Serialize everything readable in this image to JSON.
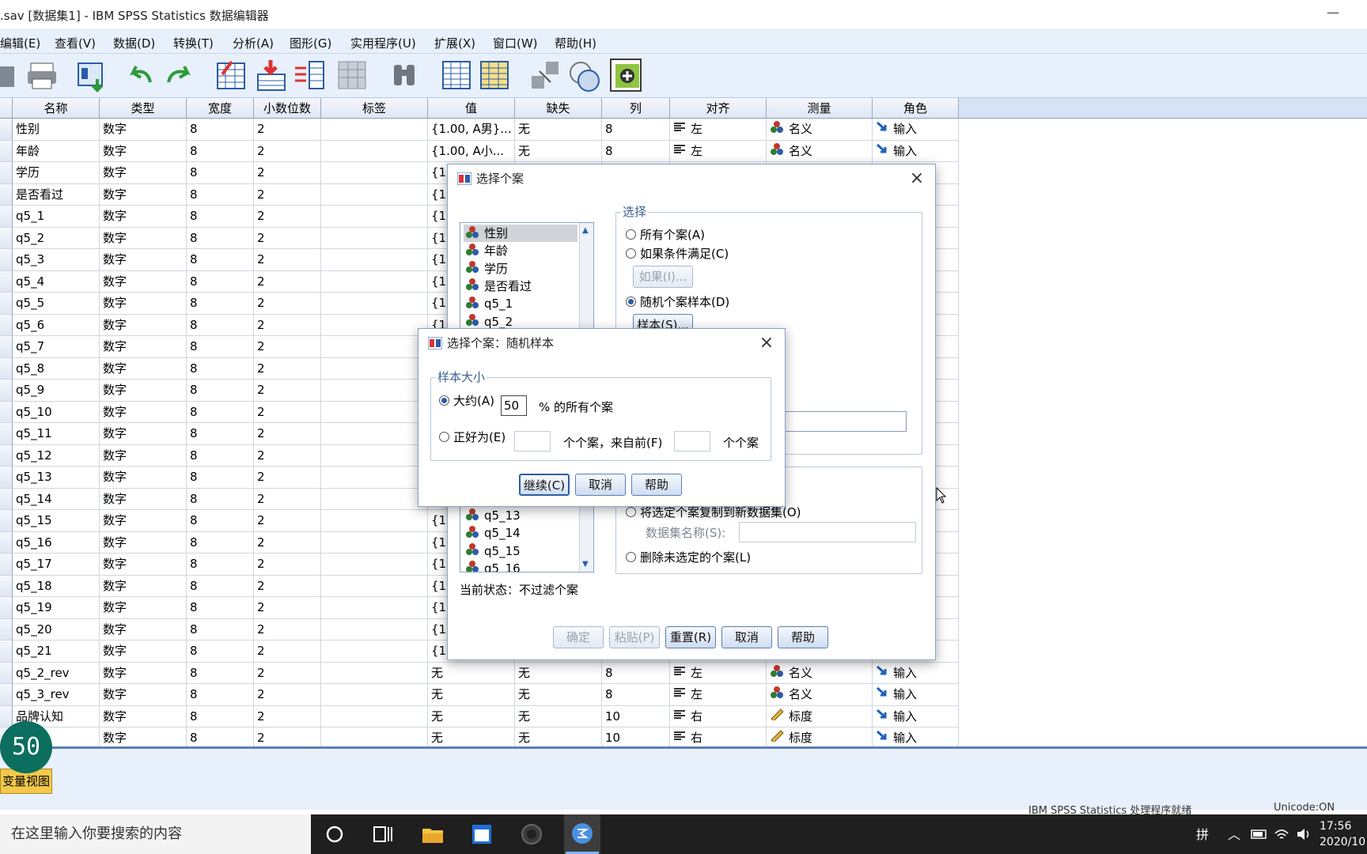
{
  "window": {
    "title": ".sav [数据集1] - IBM SPSS Statistics 数据编辑器",
    "minimize": "—"
  },
  "menu": [
    "编辑(E)",
    "查看(V)",
    "数据(D)",
    "转换(T)",
    "分析(A)",
    "图形(G)",
    "实用程序(U)",
    "扩展(X)",
    "窗口(W)",
    "帮助(H)"
  ],
  "columns": [
    "名称",
    "类型",
    "宽度",
    "小数位数",
    "标签",
    "值",
    "缺失",
    "列",
    "对齐",
    "测量",
    "角色"
  ],
  "rows": [
    [
      "性别",
      "数字",
      "8",
      "2",
      "",
      "{1.00, A男}...",
      "无",
      "8",
      "左",
      "名义",
      "输入"
    ],
    [
      "年龄",
      "数字",
      "8",
      "2",
      "",
      "{1.00, A小...",
      "无",
      "8",
      "左",
      "名义",
      "输入"
    ],
    [
      "学历",
      "数字",
      "8",
      "2",
      "",
      "{1.0",
      "",
      "",
      "",
      "",
      ""
    ],
    [
      "是否看过",
      "数字",
      "8",
      "2",
      "",
      "{1.0",
      "",
      "",
      "",
      "",
      ""
    ],
    [
      "q5_1",
      "数字",
      "8",
      "2",
      "",
      "{1.0",
      "",
      "",
      "",
      "",
      ""
    ],
    [
      "q5_2",
      "数字",
      "8",
      "2",
      "",
      "{1.0",
      "",
      "",
      "",
      "",
      ""
    ],
    [
      "q5_3",
      "数字",
      "8",
      "2",
      "",
      "{1.0",
      "",
      "",
      "",
      "",
      ""
    ],
    [
      "q5_4",
      "数字",
      "8",
      "2",
      "",
      "{1.0",
      "",
      "",
      "",
      "",
      ""
    ],
    [
      "q5_5",
      "数字",
      "8",
      "2",
      "",
      "{1.0",
      "",
      "",
      "",
      "",
      ""
    ],
    [
      "q5_6",
      "数字",
      "8",
      "2",
      "",
      "{1.0",
      "",
      "",
      "",
      "",
      ""
    ],
    [
      "q5_7",
      "数字",
      "8",
      "2",
      "",
      "",
      "",
      "",
      "",
      "",
      ""
    ],
    [
      "q5_8",
      "数字",
      "8",
      "2",
      "",
      "",
      "",
      "",
      "",
      "",
      ""
    ],
    [
      "q5_9",
      "数字",
      "8",
      "2",
      "",
      "",
      "",
      "",
      "",
      "",
      ""
    ],
    [
      "q5_10",
      "数字",
      "8",
      "2",
      "",
      "",
      "",
      "",
      "",
      "",
      ""
    ],
    [
      "q5_11",
      "数字",
      "8",
      "2",
      "",
      "",
      "",
      "",
      "",
      "",
      ""
    ],
    [
      "q5_12",
      "数字",
      "8",
      "2",
      "",
      "",
      "",
      "",
      "",
      "",
      ""
    ],
    [
      "q5_13",
      "数字",
      "8",
      "2",
      "",
      "",
      "",
      "",
      "",
      "",
      ""
    ],
    [
      "q5_14",
      "数字",
      "8",
      "2",
      "",
      "",
      "",
      "",
      "",
      "",
      ""
    ],
    [
      "q5_15",
      "数字",
      "8",
      "2",
      "",
      "{1.0",
      "",
      "",
      "",
      "",
      ""
    ],
    [
      "q5_16",
      "数字",
      "8",
      "2",
      "",
      "{1.0",
      "",
      "",
      "",
      "",
      ""
    ],
    [
      "q5_17",
      "数字",
      "8",
      "2",
      "",
      "{1.0",
      "",
      "",
      "",
      "",
      ""
    ],
    [
      "q5_18",
      "数字",
      "8",
      "2",
      "",
      "{1.0",
      "",
      "",
      "",
      "",
      ""
    ],
    [
      "q5_19",
      "数字",
      "8",
      "2",
      "",
      "{1.0",
      "",
      "",
      "",
      "",
      ""
    ],
    [
      "q5_20",
      "数字",
      "8",
      "2",
      "",
      "{1.0",
      "",
      "",
      "",
      "",
      ""
    ],
    [
      "q5_21",
      "数字",
      "8",
      "2",
      "",
      "{1.0",
      "",
      "",
      "",
      "",
      ""
    ],
    [
      "q5_2_rev",
      "数字",
      "8",
      "2",
      "",
      "无",
      "无",
      "8",
      "左",
      "名义",
      "输入"
    ],
    [
      "q5_3_rev",
      "数字",
      "8",
      "2",
      "",
      "无",
      "无",
      "8",
      "左",
      "名义",
      "输入"
    ],
    [
      "品牌认知",
      "数字",
      "8",
      "2",
      "",
      "无",
      "无",
      "10",
      "右",
      "标度",
      "输入"
    ],
    [
      "感",
      "数字",
      "8",
      "2",
      "",
      "无",
      "无",
      "10",
      "右",
      "标度",
      "输入"
    ]
  ],
  "tab_label": "变量视图",
  "status_left": "IBM SPSS Statistics 处理程序就绪",
  "status_right": "Unicode:ON",
  "overlay_number": "50",
  "dialog_main": {
    "title": "选择个案",
    "list": [
      "性别",
      "年龄",
      "学历",
      "是否看过",
      "q5_1",
      "q5_2"
    ],
    "list_bottom": [
      "q5_13",
      "q5_14",
      "q5_15",
      "q5_16"
    ],
    "select_group": "选择",
    "opt_all": "所有个案(A)",
    "opt_if": "如果条件满足(C)",
    "btn_if": "如果(I)...",
    "opt_random": "随机个案样本(D)",
    "btn_sample": "样本(S)...",
    "opt_copy": "将选定个案复制到新数据集(O)",
    "dataset_name_label": "数据集名称(S):",
    "opt_delete": "删除未选定的个案(L)",
    "status": "当前状态：不过滤个案",
    "btn_ok": "确定",
    "btn_paste": "粘贴(P)",
    "btn_reset": "重置(R)",
    "btn_cancel": "取消",
    "btn_help": "帮助"
  },
  "dialog_sample": {
    "title": "选择个案：随机样本",
    "group": "样本大小",
    "opt_approx": "大约(A)",
    "approx_value": "50",
    "approx_suffix": "% 的所有个案",
    "opt_exact": "正好为(E)",
    "exact_mid": "个个案，来自前(F)",
    "exact_suffix": "个个案",
    "btn_continue": "继续(C)",
    "btn_cancel": "取消",
    "btn_help": "帮助"
  },
  "taskbar": {
    "search": "在这里输入你要搜索的内容",
    "ime": "拼",
    "time": "17:56",
    "date": "2020/10"
  }
}
